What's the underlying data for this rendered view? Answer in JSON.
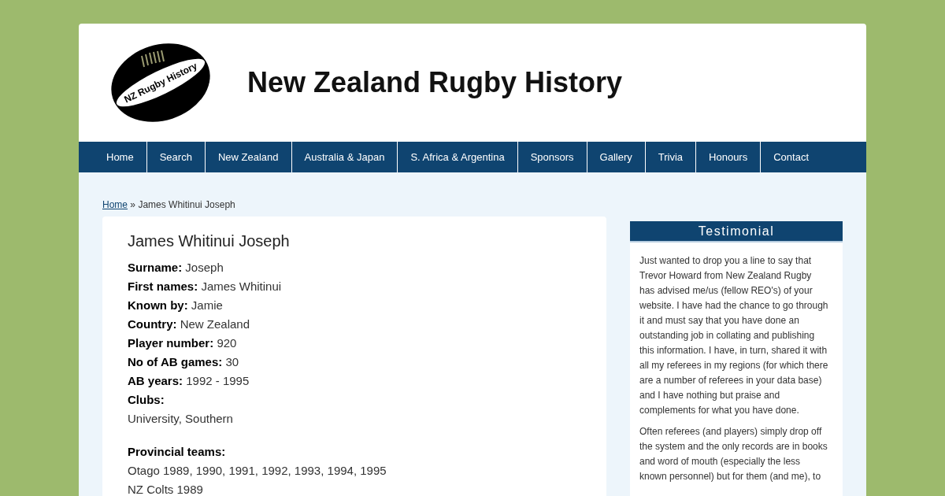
{
  "header": {
    "logo_text": "NZ Rugby History",
    "site_title": "New Zealand Rugby History"
  },
  "nav": [
    {
      "label": "Home"
    },
    {
      "label": "Search"
    },
    {
      "label": "New Zealand"
    },
    {
      "label": "Australia & Japan"
    },
    {
      "label": "S. Africa & Argentina"
    },
    {
      "label": "Sponsors"
    },
    {
      "label": "Gallery"
    },
    {
      "label": "Trivia"
    },
    {
      "label": "Honours"
    },
    {
      "label": "Contact"
    }
  ],
  "breadcrumb": {
    "link": "Home",
    "separator": "»",
    "current": "James Whitinui Joseph"
  },
  "player": {
    "name": "James Whitinui Joseph",
    "fields": [
      {
        "label": "Surname:",
        "value": "Joseph"
      },
      {
        "label": "First names:",
        "value": "James Whitinui"
      },
      {
        "label": "Known by:",
        "value": "Jamie"
      },
      {
        "label": "Country:",
        "value": "New Zealand"
      },
      {
        "label": "Player number:",
        "value": "920"
      },
      {
        "label": "No of AB games:",
        "value": "30"
      },
      {
        "label": "AB years:",
        "value": "1992 - 1995"
      }
    ],
    "clubs": {
      "label": "Clubs:",
      "lines": [
        "University, Southern"
      ]
    },
    "provincial": {
      "label": "Provincial teams:",
      "lines": [
        "Otago 1989, 1990, 1991, 1992, 1993, 1994, 1995",
        "NZ Colts 1989"
      ]
    }
  },
  "sidebar": {
    "title": "Testimonial",
    "paragraphs": [
      "Just wanted to drop you a line to say that Trevor Howard from New Zealand Rugby has advised me/us (fellow REO's) of your website. I have had the chance to go through it and must say that you have done an outstanding job in collating and publishing this information. I have, in turn, shared it with all my referees in my regions (for which there are a number of referees in your data base) and I have nothing but praise and complements for what you have done.",
      "Often referees (and players) simply drop off the system and the only records are in books and word of mouth (especially the less known personnel) but for them (and me), to"
    ]
  }
}
